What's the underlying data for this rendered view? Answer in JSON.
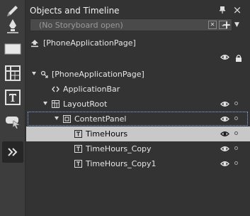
{
  "panel": {
    "title": "Objects and Timeline",
    "storyboard_placeholder": "(No Storyboard open)",
    "add_label": "+",
    "close_label": "×"
  },
  "scope": {
    "label": "[PhoneApplicationPage]"
  },
  "tree": [
    {
      "label": "[PhoneApplicationPage]",
      "level": 0,
      "expanded": true,
      "icon": "page-icon"
    },
    {
      "label": "ApplicationBar",
      "level": 1,
      "expanded": null,
      "icon": "tag-icon"
    },
    {
      "label": "LayoutRoot",
      "level": 1,
      "expanded": true,
      "icon": "grid-icon"
    },
    {
      "label": "ContentPanel",
      "level": 2,
      "expanded": true,
      "icon": "stackpanel-icon"
    },
    {
      "label": "TimeHours",
      "level": 3,
      "expanded": null,
      "icon": "textblock-icon"
    },
    {
      "label": "TimeHours_Copy",
      "level": 3,
      "expanded": null,
      "icon": "textblock-icon"
    },
    {
      "label": "TimeHours_Copy1",
      "level": 3,
      "expanded": null,
      "icon": "textblock-icon"
    }
  ],
  "tools": [
    "pen-icon",
    "pen-nib-icon",
    "rectangle-icon",
    "grid-layout-icon",
    "text-tool-icon",
    "assets-icon",
    "expand-tools-icon"
  ],
  "colors": {
    "panel_bg": "#333333",
    "selected_row_bg": "#c8c8c8",
    "focus_outline": "#8ab4f8"
  }
}
